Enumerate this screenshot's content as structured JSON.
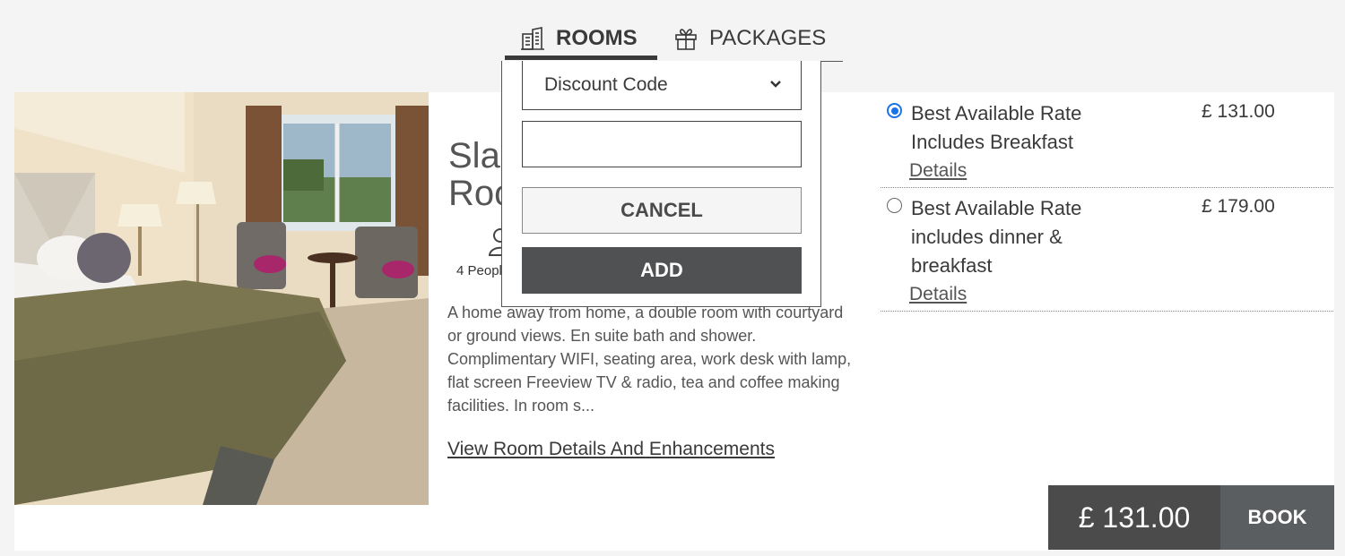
{
  "tabs": {
    "rooms": {
      "label": "ROOMS",
      "icon": "building-icon"
    },
    "packages": {
      "label": "PACKAGES",
      "icon": "gift-icon"
    }
  },
  "room": {
    "title": "Slaley Hall Double Room",
    "guests_label": "4 People",
    "description": "A home away from home, a double room with courtyard or ground views. En suite bath and shower. Complimentary WIFI, seating area, work desk with lamp, flat screen Freeview TV & radio, tea and coffee making facilities. In room s...",
    "details_link": "View Room Details And Enhancements"
  },
  "rates": [
    {
      "name": "Best Available Rate Includes Breakfast",
      "price": "£ 131.00",
      "details": "Details",
      "selected": true
    },
    {
      "name": "Best Available Rate includes dinner & breakfast",
      "price": "£ 179.00",
      "details": "Details",
      "selected": false
    }
  ],
  "booking": {
    "price": "£ 131.00",
    "book_label": "BOOK"
  },
  "promo": {
    "select_value": "Discount Code",
    "input_value": "",
    "cancel_label": "CANCEL",
    "add_label": "ADD"
  },
  "colors": {
    "accent": "#1a73e8",
    "dark": "#4b4b4b"
  }
}
